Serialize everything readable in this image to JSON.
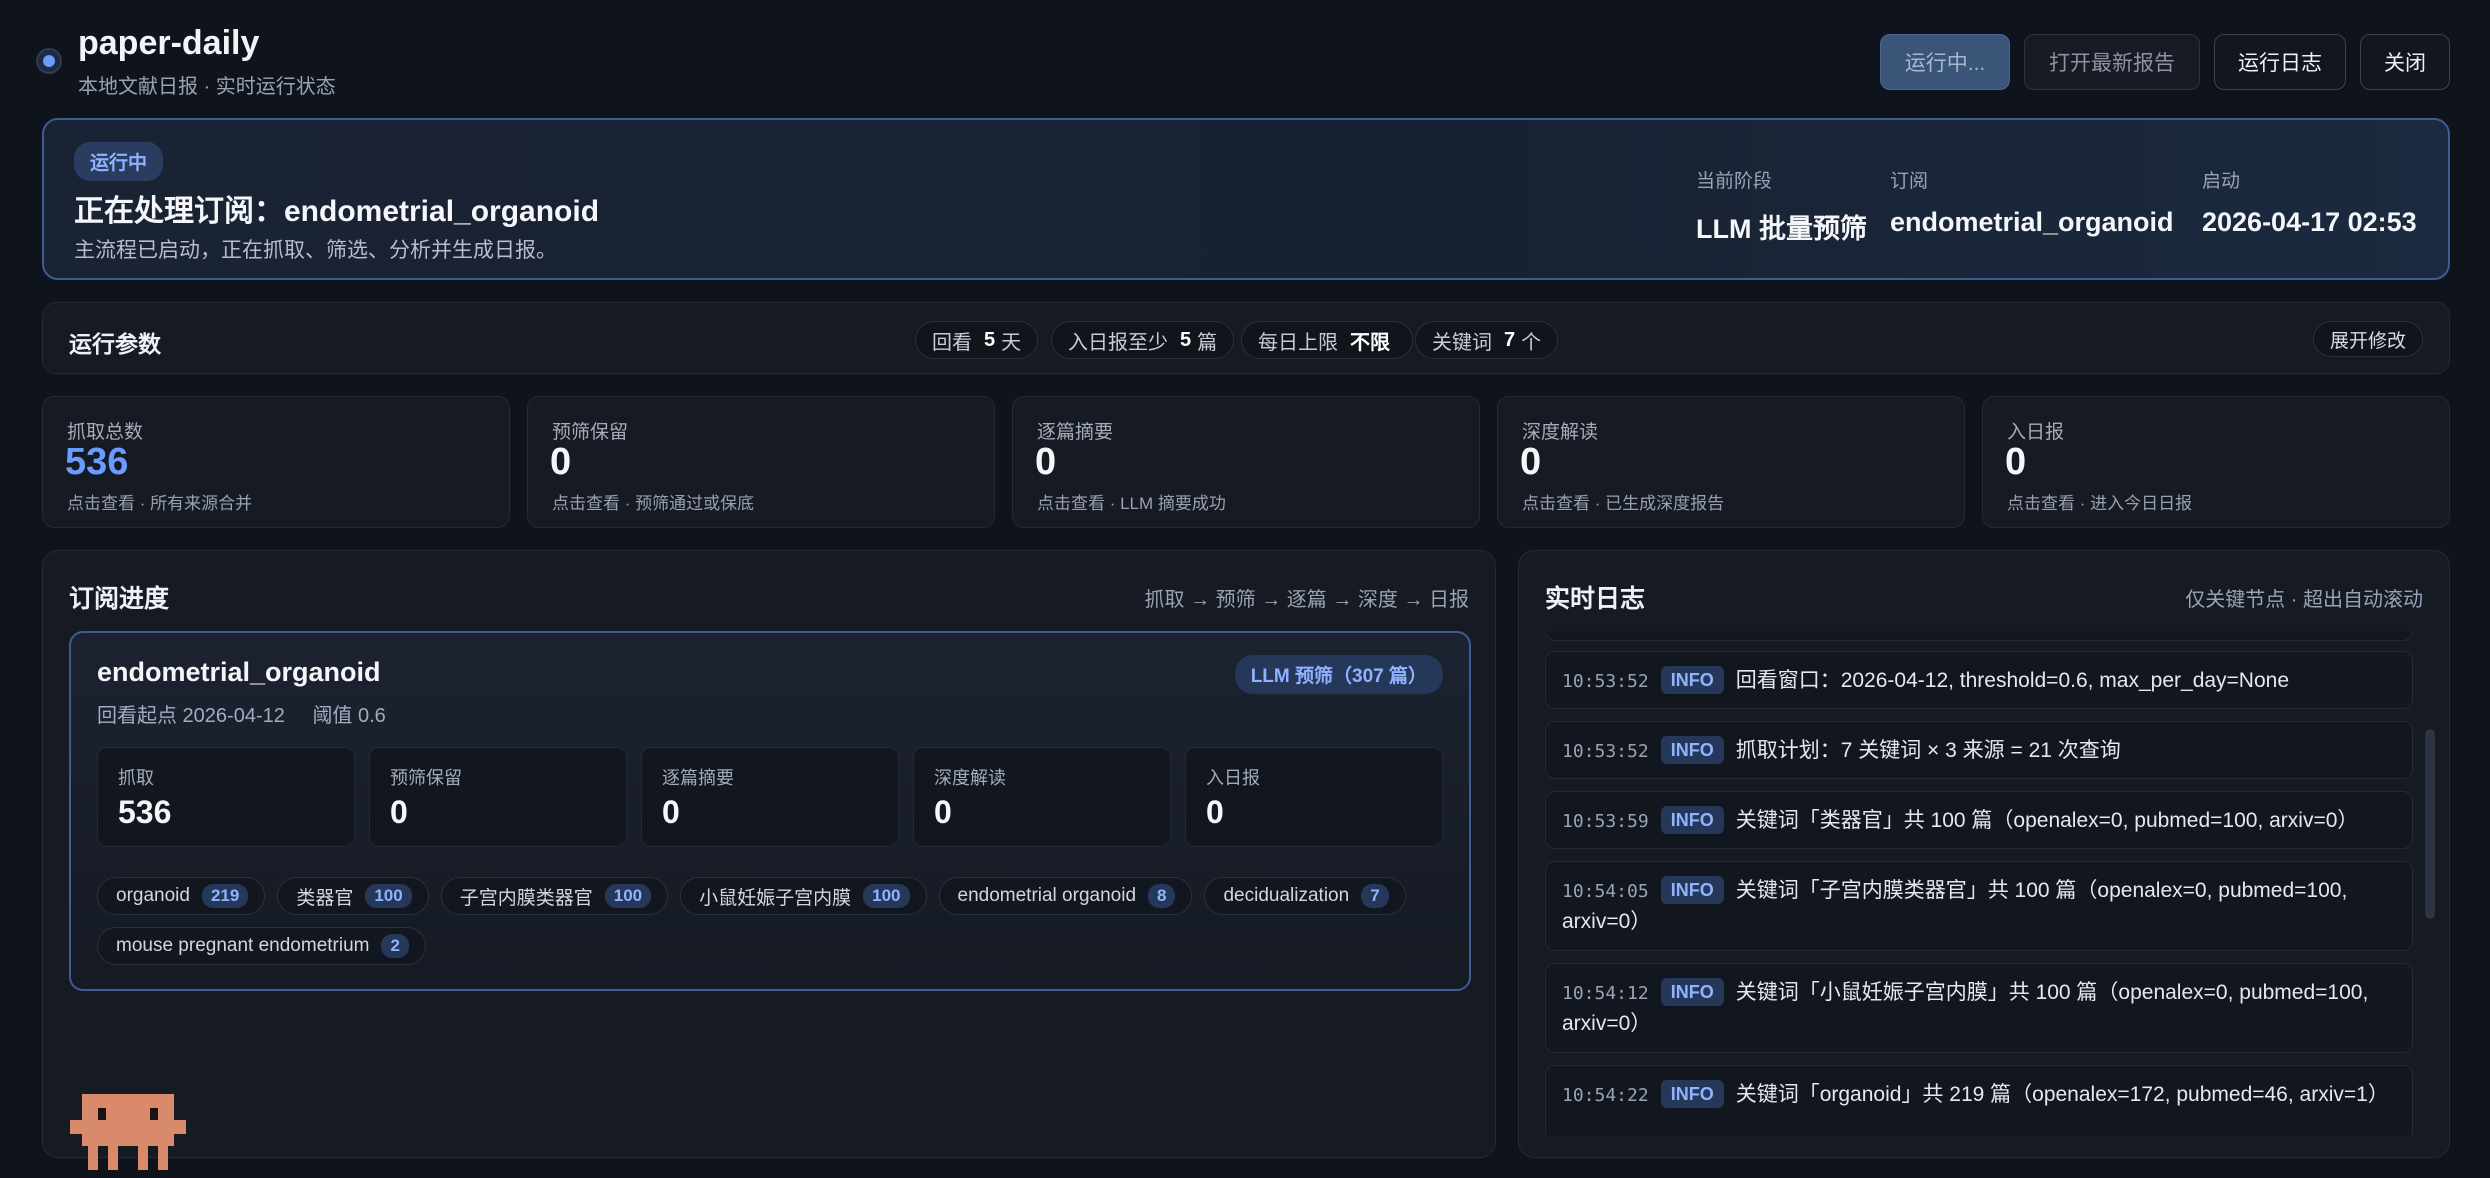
{
  "app": {
    "title": "paper-daily",
    "subtitle": "本地文献日报 · 实时运行状态"
  },
  "header_buttons": {
    "running": "运行中...",
    "open_report": "打开最新报告",
    "run_log": "运行日志",
    "close": "关闭"
  },
  "banner": {
    "badge": "运行中",
    "title": "正在处理订阅：endometrial_organoid",
    "subtitle": "主流程已启动，正在抓取、筛选、分析并生成日报。",
    "stage_label": "当前阶段",
    "stage_value": "LLM 批量预筛",
    "sub_label": "订阅",
    "sub_value": "endometrial_organoid",
    "start_label": "启动",
    "start_value": "2026-04-17 02:53"
  },
  "params": {
    "title": "运行参数",
    "lookback_label": "回看",
    "lookback_value": "5",
    "lookback_unit": "天",
    "min_label": "入日报至少",
    "min_value": "5",
    "min_unit": "篇",
    "daily_label": "每日上限",
    "daily_value": "不限",
    "kw_label": "关键词",
    "kw_value": "7",
    "kw_unit": "个",
    "expand": "展开修改"
  },
  "stats": [
    {
      "label": "抓取总数",
      "value": "536",
      "note": "点击查看 · 所有来源合并"
    },
    {
      "label": "预筛保留",
      "value": "0",
      "note": "点击查看 · 预筛通过或保底"
    },
    {
      "label": "逐篇摘要",
      "value": "0",
      "note": "点击查看 · LLM 摘要成功"
    },
    {
      "label": "深度解读",
      "value": "0",
      "note": "点击查看 · 已生成深度报告"
    },
    {
      "label": "入日报",
      "value": "0",
      "note": "点击查看 · 进入今日日报"
    }
  ],
  "progress": {
    "title": "订阅进度",
    "pipeline": "抓取 → 预筛 → 逐篇 → 深度 → 日报",
    "sub_name": "endometrial_organoid",
    "lookback": "回看起点 2026-04-12",
    "threshold": "阈值 0.6",
    "stage": "LLM 预筛（307 篇）",
    "mini": [
      {
        "label": "抓取",
        "value": "536"
      },
      {
        "label": "预筛保留",
        "value": "0"
      },
      {
        "label": "逐篇摘要",
        "value": "0"
      },
      {
        "label": "深度解读",
        "value": "0"
      },
      {
        "label": "入日报",
        "value": "0"
      }
    ],
    "tags": [
      {
        "name": "organoid",
        "count": "219"
      },
      {
        "name": "类器官",
        "count": "100"
      },
      {
        "name": "子宫内膜类器官",
        "count": "100"
      },
      {
        "name": "小鼠妊娠子宫内膜",
        "count": "100"
      },
      {
        "name": "endometrial organoid",
        "count": "8"
      },
      {
        "name": "decidualization",
        "count": "7"
      },
      {
        "name": "mouse pregnant endometrium",
        "count": "2"
      }
    ]
  },
  "log": {
    "title": "实时日志",
    "hint": "仅关键节点 · 超出自动滚动",
    "entries": [
      {
        "time": "10:53:52",
        "level": "INFO",
        "text": "回看窗口：2026-04-12, threshold=0.6, max_per_day=None"
      },
      {
        "time": "10:53:52",
        "level": "INFO",
        "text": "抓取计划：7 关键词 × 3 来源 = 21 次查询"
      },
      {
        "time": "10:53:59",
        "level": "INFO",
        "text": "关键词「类器官」共 100 篇（openalex=0, pubmed=100, arxiv=0）"
      },
      {
        "time": "10:54:05",
        "level": "INFO",
        "text": "关键词「子宫内膜类器官」共 100 篇（openalex=0, pubmed=100, arxiv=0）"
      },
      {
        "time": "10:54:12",
        "level": "INFO",
        "text": "关键词「小鼠妊娠子宫内膜」共 100 篇（openalex=0, pubmed=100, arxiv=0）"
      },
      {
        "time": "10:54:22",
        "level": "INFO",
        "text": "关键词「organoid」共 219 篇（openalex=172, pubmed=46, arxiv=1）"
      }
    ]
  }
}
